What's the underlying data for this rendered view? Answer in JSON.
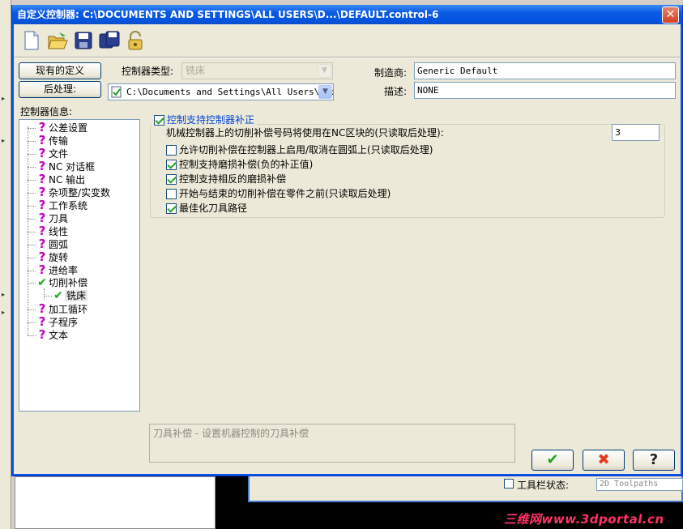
{
  "window": {
    "title": "自定义控制器: C:\\DOCUMENTS AND SETTINGS\\ALL USERS\\D...\\DEFAULT.control-6",
    "close_label": "✕"
  },
  "toolbar": {
    "icons": [
      "new-file-icon",
      "open-folder-icon",
      "save-icon",
      "save-as-icon",
      "lock-icon"
    ]
  },
  "buttons": {
    "existing_definitions": "现有的定义",
    "post_processor": "后处理:"
  },
  "controller_type": {
    "label": "控制器类型:",
    "value": "铣床"
  },
  "post_path": {
    "value": "C:\\Documents and Settings\\All Users\\Doc"
  },
  "manufacturer": {
    "label": "制造商:",
    "value": "Generic Default"
  },
  "description": {
    "label": "描述:",
    "value": "NONE"
  },
  "tree": {
    "header": "控制器信息:",
    "items": [
      {
        "label": "公差设置",
        "status": "unknown"
      },
      {
        "label": "传输",
        "status": "unknown"
      },
      {
        "label": "文件",
        "status": "unknown"
      },
      {
        "label": "NC 对话框",
        "status": "unknown"
      },
      {
        "label": "NC 输出",
        "status": "unknown"
      },
      {
        "label": "杂项整/实变数",
        "status": "unknown"
      },
      {
        "label": "工作系统",
        "status": "unknown"
      },
      {
        "label": "刀具",
        "status": "unknown"
      },
      {
        "label": "线性",
        "status": "unknown"
      },
      {
        "label": "圆弧",
        "status": "unknown"
      },
      {
        "label": "旋转",
        "status": "unknown"
      },
      {
        "label": "进给率",
        "status": "unknown"
      },
      {
        "label": "切削补偿",
        "status": "done"
      },
      {
        "label": "铣床",
        "status": "done",
        "child": true
      },
      {
        "label": "加工循环",
        "status": "unknown"
      },
      {
        "label": "子程序",
        "status": "unknown"
      },
      {
        "label": "文本",
        "status": "unknown"
      }
    ]
  },
  "compensation": {
    "group_label": "控制支持控制器补正",
    "group_checked": true,
    "offset_label": "机械控制器上的切削补偿号码将使用在NC区块的(只读取后处理):",
    "offset_value": "3",
    "options": [
      {
        "label": "允许切削补偿在控制器上启用/取消在圆弧上(只读取后处理)",
        "checked": false
      },
      {
        "label": "控制支持磨损补偿(负的补正值)",
        "checked": true
      },
      {
        "label": "控制支持相反的磨损补偿",
        "checked": true
      },
      {
        "label": "开始与结束的切削补偿在零件之前(只读取后处理)",
        "checked": false
      },
      {
        "label": "最佳化刀具路径",
        "checked": true
      }
    ]
  },
  "help_text": "刀具补偿 - 设置机器控制的刀具补偿",
  "dialog_buttons": {
    "ok": "✔",
    "cancel": "✖",
    "help": "?"
  },
  "background": {
    "toolbar_status_label": "工具栏状态:",
    "toolbar_status_value": "2D Toolpaths",
    "watermark": "三维网www.3dportal.cn"
  }
}
